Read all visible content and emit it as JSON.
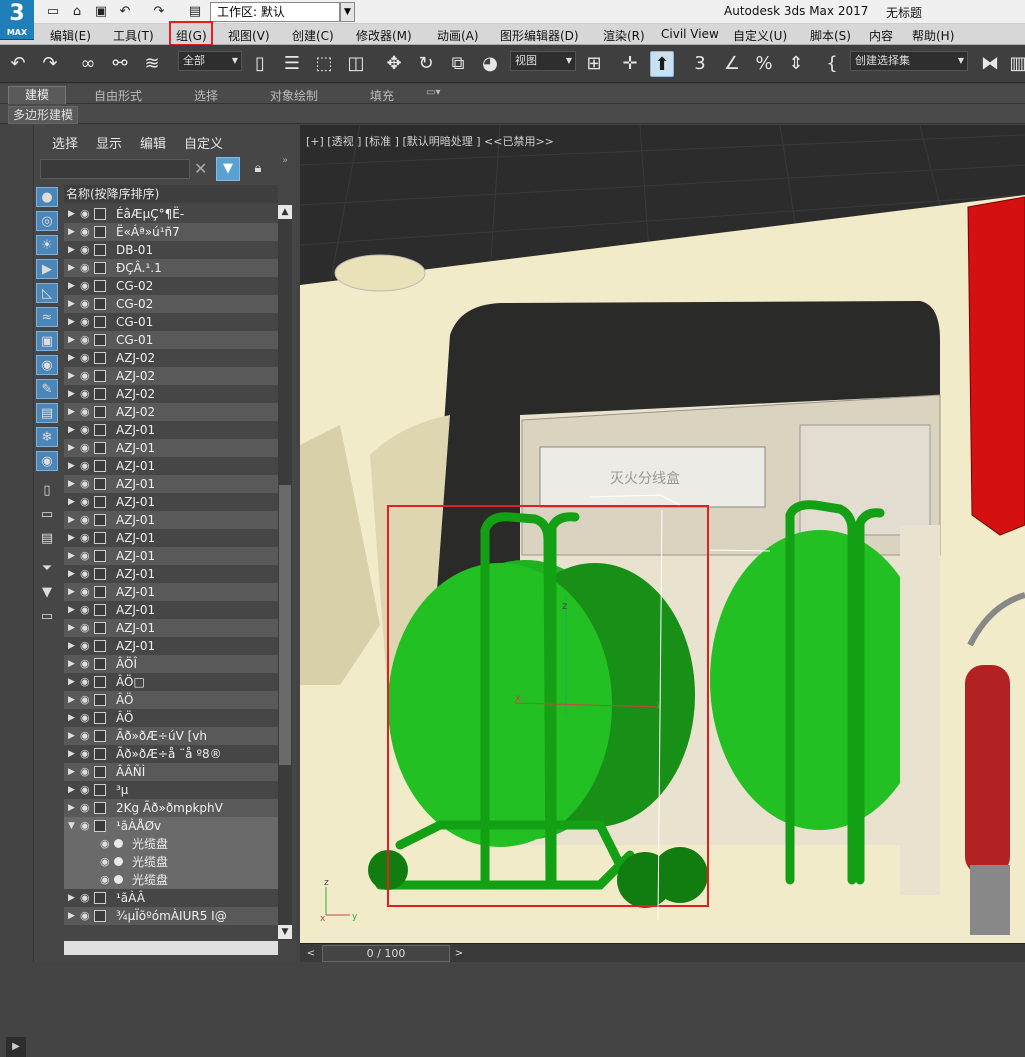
{
  "app": {
    "logo_main": "3",
    "logo_sub": "MAX",
    "title": "Autodesk 3ds Max 2017",
    "document": "无标题",
    "workspace": "工作区: 默认"
  },
  "menu": [
    "编辑(E)",
    "工具(T)",
    "组(G)",
    "视图(V)",
    "创建(C)",
    "修改器(M)",
    "动画(A)",
    "图形编辑器(D)",
    "渲染(R)",
    "Civil View",
    "自定义(U)",
    "脚本(S)",
    "内容",
    "帮助(H)"
  ],
  "toolbar": {
    "selection_filter": "全部",
    "reference_coord": "视图",
    "named_selection": "创建选择集"
  },
  "ribbon": {
    "tabs": [
      "建模",
      "自由形式",
      "选择",
      "对象绘制",
      "填充"
    ],
    "sub_label": "多边形建模"
  },
  "explorer": {
    "menu": [
      "选择",
      "显示",
      "编辑",
      "自定义"
    ],
    "column_header": "名称(按降序排序)",
    "rows": [
      {
        "label": "ÉâÆµÇ°¶Ë-"
      },
      {
        "label": "Ë«Áª»ú¹ñ7"
      },
      {
        "label": "DB-01"
      },
      {
        "label": "ÐÇÂ.¹.1"
      },
      {
        "label": "CG-02"
      },
      {
        "label": "CG-02"
      },
      {
        "label": "CG-01"
      },
      {
        "label": "CG-01"
      },
      {
        "label": "AZJ-02"
      },
      {
        "label": "AZJ-02"
      },
      {
        "label": "AZJ-02"
      },
      {
        "label": "AZJ-02"
      },
      {
        "label": "AZJ-01"
      },
      {
        "label": "AZJ-01"
      },
      {
        "label": "AZJ-01"
      },
      {
        "label": "AZJ-01"
      },
      {
        "label": "AZJ-01"
      },
      {
        "label": "AZJ-01"
      },
      {
        "label": "AZJ-01"
      },
      {
        "label": "AZJ-01"
      },
      {
        "label": "AZJ-01"
      },
      {
        "label": "AZJ-01"
      },
      {
        "label": "AZJ-01"
      },
      {
        "label": "AZJ-01"
      },
      {
        "label": "AZJ-01"
      },
      {
        "label": "ÂÖÎ"
      },
      {
        "label": "ÂÖ□"
      },
      {
        "label": "ÂÖ"
      },
      {
        "label": "ÂÖ"
      },
      {
        "label": "Ãð»ðÆ÷úV   [vh"
      },
      {
        "label": "Ãð»ðÆ÷å   ¨å   º8®"
      },
      {
        "label": "ÂÂÑÌ"
      },
      {
        "label": "³µ"
      },
      {
        "label": "2Kg Ãð»ðmpkphV"
      },
      {
        "label": "¹ãÀÅØv"
      },
      {
        "label": "光缆盘"
      },
      {
        "label": "光缆盘"
      },
      {
        "label": "光缆盘"
      },
      {
        "label": "¹ãÀÂ"
      },
      {
        "label": "¾µÏõºómÀIUR5    I@"
      }
    ]
  },
  "viewport": {
    "label": "[+] [透视 ] [标准 ] [默认明暗处理 ]  <<已禁用>>",
    "axis_x": "x",
    "axis_y": "y",
    "axis_z": "z",
    "box_text": "灭火分线盒"
  },
  "timeline": {
    "frame": "0 / 100",
    "prev": "<",
    "next": ">"
  }
}
